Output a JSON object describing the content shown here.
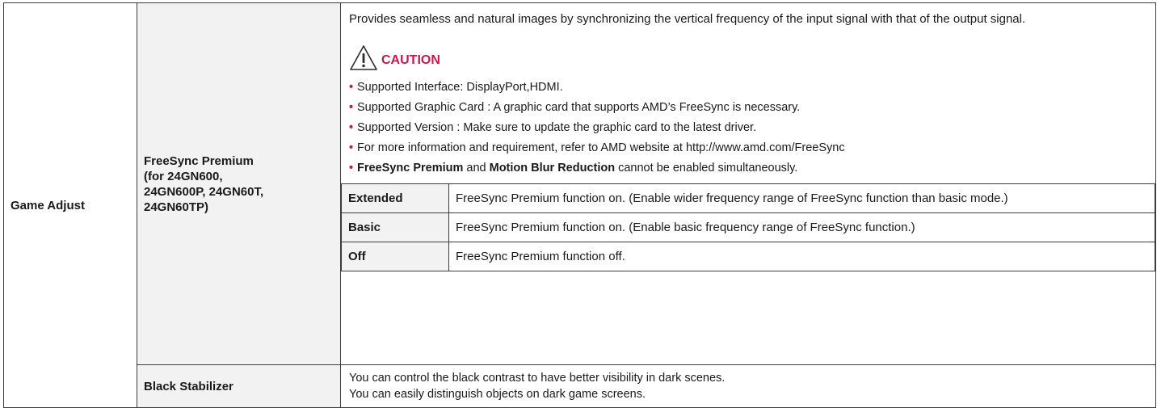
{
  "category": "Game Adjust",
  "freesync": {
    "name_lines": [
      "FreeSync Premium",
      "(for 24GN600,",
      "24GN600P, 24GN60T,",
      "24GN60TP)"
    ],
    "intro": "Provides seamless and natural images by synchronizing the vertical frequency of the input signal with that of the output signal.",
    "caution_title": "CAUTION",
    "caution_icon": "warning-triangle-icon",
    "bullets": [
      "Supported Interface: DisplayPort,HDMI.",
      "Supported Graphic Card : A graphic card that supports AMD’s FreeSync is necessary.",
      "Supported Version : Make sure to update the graphic card to the latest driver.",
      "For more information and requirement, refer to AMD website at http://www.amd.com/FreeSync"
    ],
    "last_bullet": {
      "part1": "FreeSync Premium",
      "part2": " and ",
      "part3": "Motion Blur Reduction",
      "part4": " cannot be enabled simultaneously."
    },
    "options": [
      {
        "label": "Extended",
        "desc": "FreeSync Premium function on. (Enable wider frequency range of FreeSync function than basic mode.)"
      },
      {
        "label": "Basic",
        "desc": "FreeSync Premium function on. (Enable basic frequency range of FreeSync function.)"
      },
      {
        "label": "Off",
        "desc": "FreeSync Premium function off."
      }
    ]
  },
  "black_stabilizer": {
    "name": "Black Stabilizer",
    "lines": [
      "You can control the black contrast to have better visibility in dark scenes.",
      "You can easily distinguish objects on dark game screens."
    ]
  },
  "colors": {
    "accent": "#c6174e",
    "label_bg": "#f2f2f2",
    "border": "#3c3c3c"
  }
}
